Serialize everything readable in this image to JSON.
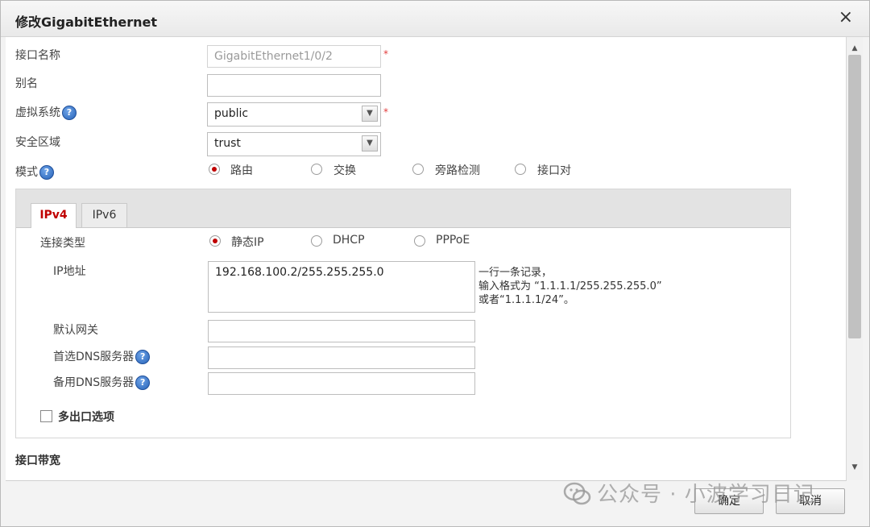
{
  "dialog": {
    "title": "修改GigabitEthernet",
    "close": "×"
  },
  "form": {
    "interface_name": {
      "label": "接口名称",
      "value": "GigabitEthernet1/0/2"
    },
    "alias": {
      "label": "别名",
      "value": ""
    },
    "virtual_system": {
      "label": "虚拟系统",
      "value": "public"
    },
    "security_zone": {
      "label": "安全区域",
      "value": "trust"
    },
    "mode": {
      "label": "模式",
      "options": [
        "路由",
        "交换",
        "旁路检测",
        "接口对"
      ],
      "selected": "路由"
    },
    "required_mark": "*"
  },
  "ip_section": {
    "tabs": [
      "IPv4",
      "IPv6"
    ],
    "active_tab": "IPv4",
    "connection_type": {
      "label": "连接类型",
      "options": [
        "静态IP",
        "DHCP",
        "PPPoE"
      ],
      "selected": "静态IP"
    },
    "ip_address": {
      "label": "IP地址",
      "value": "192.168.100.2/255.255.255.0",
      "hint_lines": [
        "一行一条记录，",
        "输入格式为 “1.1.1.1/255.255.255.0”",
        "或者“1.1.1.1/24”。"
      ]
    },
    "default_gateway": {
      "label": "默认网关",
      "value": ""
    },
    "primary_dns": {
      "label": "首选DNS服务器",
      "value": ""
    },
    "secondary_dns": {
      "label": "备用DNS服务器",
      "value": ""
    },
    "multi_exit": {
      "label": "多出口选项",
      "checked": false
    }
  },
  "bandwidth_section": {
    "label": "接口带宽"
  },
  "footer": {
    "ok": "确定",
    "cancel": "取消"
  },
  "watermark": "公众号 · 小波学习日记",
  "icons": {
    "help": "help-icon",
    "close": "close-icon",
    "dropdown": "chevron-down-icon",
    "scroll_up": "scroll-up-icon",
    "scroll_down": "scroll-down-icon"
  },
  "colors": {
    "accent_red": "#c00000",
    "required": "#e23b3b",
    "help_blue": "#2763b8"
  }
}
